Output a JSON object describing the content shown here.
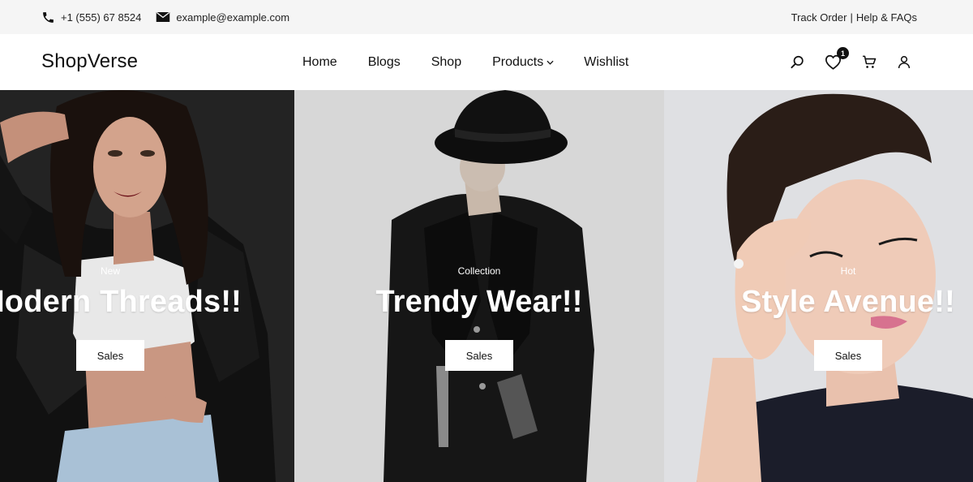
{
  "topbar": {
    "phone": "+1 (555) 67 8524",
    "email": "example@example.com",
    "track_order": "Track Order",
    "separator": "|",
    "help": "Help & FAQs"
  },
  "header": {
    "logo": "ShopVerse",
    "nav": {
      "home": "Home",
      "blogs": "Blogs",
      "shop": "Shop",
      "products": "Products",
      "wishlist": "Wishlist"
    },
    "wishlist_count": "1"
  },
  "slides": [
    {
      "tag": "New",
      "title": "Modern Threads!!",
      "button": "Sales"
    },
    {
      "tag": "Collection",
      "title": "Trendy Wear!!",
      "button": "Sales"
    },
    {
      "tag": "Hot",
      "title": "Style Avenue!!",
      "button": "Sales"
    }
  ],
  "icons": {
    "phone": "phone-icon",
    "email": "envelope-icon",
    "search": "search-icon",
    "wishlist": "heart-icon",
    "cart": "cart-icon",
    "account": "user-icon",
    "dropdown": "chevron-down-icon"
  }
}
